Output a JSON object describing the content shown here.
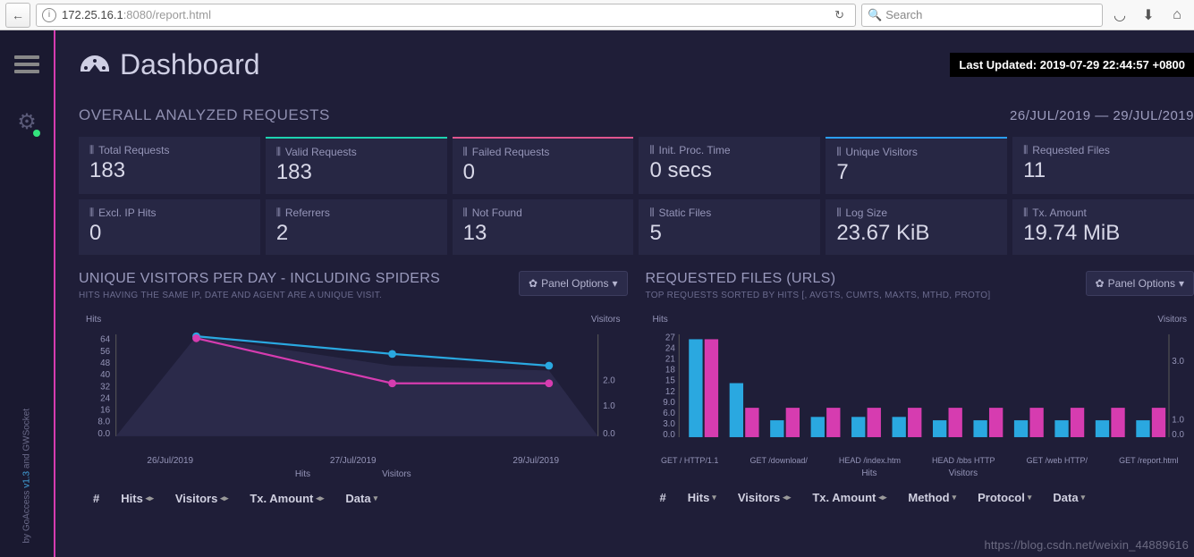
{
  "browser": {
    "url_host": "172.25.16.1",
    "url_rest": ":8080/report.html",
    "search_placeholder": "Search"
  },
  "header": {
    "title": "Dashboard",
    "last_updated_label": "Last Updated: ",
    "last_updated_value": "2019-07-29 22:44:57 +0800"
  },
  "section": {
    "title": "OVERALL ANALYZED REQUESTS",
    "date_range": "26/JUL/2019 — 29/JUL/2019"
  },
  "stats_row1": [
    {
      "label": "Total Requests",
      "value": "183",
      "accent": ""
    },
    {
      "label": "Valid Requests",
      "value": "183",
      "accent": "teal"
    },
    {
      "label": "Failed Requests",
      "value": "0",
      "accent": "pink"
    },
    {
      "label": "Init. Proc. Time",
      "value": "0 secs",
      "accent": ""
    },
    {
      "label": "Unique Visitors",
      "value": "7",
      "accent": "blue"
    },
    {
      "label": "Requested Files",
      "value": "11",
      "accent": ""
    }
  ],
  "stats_row2": [
    {
      "label": "Excl. IP Hits",
      "value": "0"
    },
    {
      "label": "Referrers",
      "value": "2"
    },
    {
      "label": "Not Found",
      "value": "13"
    },
    {
      "label": "Static Files",
      "value": "5"
    },
    {
      "label": "Log Size",
      "value": "23.67 KiB"
    },
    {
      "label": "Tx. Amount",
      "value": "19.74 MiB"
    }
  ],
  "panel_options_label": "Panel Options",
  "panel1": {
    "title": "UNIQUE VISITORS PER DAY - INCLUDING SPIDERS",
    "subtitle": "HITS HAVING THE SAME IP, DATE AND AGENT ARE A UNIQUE VISIT.",
    "y_left_label": "Hits",
    "y_right_label": "Visitors",
    "legend": [
      "Hits",
      "Visitors"
    ],
    "columns": [
      "#",
      "Hits",
      "Visitors",
      "Tx. Amount",
      "Data"
    ]
  },
  "panel2": {
    "title": "REQUESTED FILES (URLS)",
    "subtitle": "TOP REQUESTS SORTED BY HITS [, AVGTS, CUMTS, MAXTS, MTHD, PROTO]",
    "y_left_label": "Hits",
    "y_right_label": "Visitors",
    "legend": [
      "Hits",
      "Visitors"
    ],
    "columns": [
      "#",
      "Hits",
      "Visitors",
      "Tx. Amount",
      "Method",
      "Protocol",
      "Data"
    ]
  },
  "credits": "by GoAccess v1.3 and GWSocket",
  "watermark": "https://blog.csdn.net/weixin_44889616",
  "chart_data": [
    {
      "type": "line",
      "title": "UNIQUE VISITORS PER DAY - INCLUDING SPIDERS",
      "categories": [
        "26/Jul/2019",
        "27/Jul/2019",
        "29/Jul/2019"
      ],
      "series": [
        {
          "name": "Hits",
          "values": [
            70,
            60,
            53
          ],
          "color": "#2aa8e0"
        },
        {
          "name": "Visitors",
          "values": [
            3.0,
            2.0,
            2.0
          ],
          "color": "#d63cb0"
        }
      ],
      "y_left_ticks": [
        0.0,
        8.0,
        16,
        24,
        32,
        40,
        48,
        56,
        64
      ],
      "y_right_ticks": [
        0.0,
        1.0,
        2.0
      ]
    },
    {
      "type": "bar",
      "title": "REQUESTED FILES (URLS)",
      "categories": [
        "GET / HTTP/1.1",
        "GET /download/",
        "HEAD /index.htm",
        "HEAD /bbs HTTP",
        "GET /web HTTP/",
        "GET /report.html"
      ],
      "series": [
        {
          "name": "Hits",
          "values": [
            29,
            16,
            5,
            6,
            6,
            6,
            5,
            5,
            5,
            5,
            5,
            5
          ],
          "color": "#2aa8e0"
        },
        {
          "name": "Visitors",
          "values": [
            3.0,
            1.0,
            1.0,
            1.0,
            1.0,
            1.0,
            1.0,
            1.0,
            1.0,
            1.0,
            1.0,
            1.0
          ],
          "color": "#d63cb0"
        }
      ],
      "y_left_ticks": [
        0.0,
        3.0,
        6.0,
        9.0,
        12,
        15,
        18,
        21,
        24,
        27
      ],
      "y_right_ticks": [
        0.0,
        1.0,
        3.0
      ]
    }
  ]
}
